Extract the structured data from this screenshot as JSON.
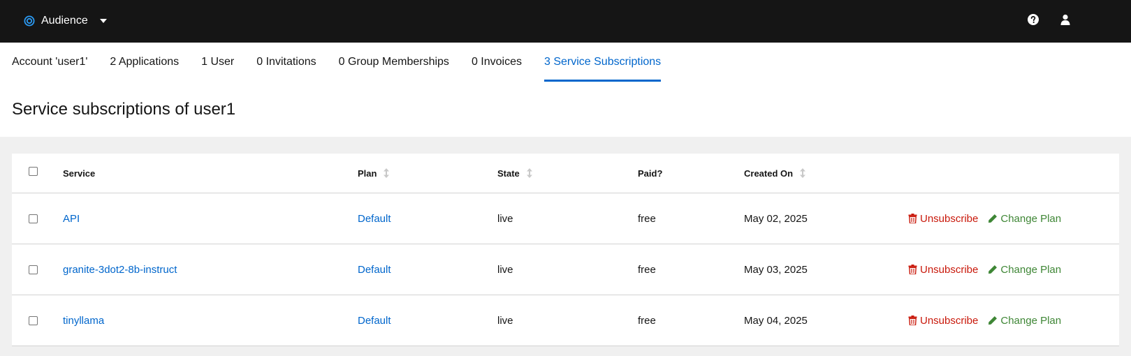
{
  "topbar": {
    "app_name": "Audience",
    "app_icon": "target-circle-icon",
    "help_icon": "help-circle-icon",
    "user_icon": "user-icon"
  },
  "tabs": [
    {
      "label": "Account 'user1'",
      "active": false
    },
    {
      "label": "2 Applications",
      "active": false
    },
    {
      "label": "1 User",
      "active": false
    },
    {
      "label": "0 Invitations",
      "active": false
    },
    {
      "label": "0 Group Memberships",
      "active": false
    },
    {
      "label": "0 Invoices",
      "active": false
    },
    {
      "label": "3 Service Subscriptions",
      "active": true
    }
  ],
  "page": {
    "title": "Service subscriptions of user1"
  },
  "table": {
    "columns": {
      "service": "Service",
      "plan": "Plan",
      "state": "State",
      "paid": "Paid?",
      "created_on": "Created On"
    },
    "actions": {
      "unsubscribe": "Unsubscribe",
      "change_plan": "Change Plan"
    },
    "rows": [
      {
        "service": "API",
        "plan": "Default",
        "state": "live",
        "paid": "free",
        "created_on": "May 02, 2025"
      },
      {
        "service": "granite-3dot2-8b-instruct",
        "plan": "Default",
        "state": "live",
        "paid": "free",
        "created_on": "May 03, 2025"
      },
      {
        "service": "tinyllama",
        "plan": "Default",
        "state": "live",
        "paid": "free",
        "created_on": "May 04, 2025"
      }
    ]
  },
  "colors": {
    "topbar": "#151515",
    "link": "#0066cc",
    "danger": "#c9190b",
    "success": "#3e8635"
  }
}
